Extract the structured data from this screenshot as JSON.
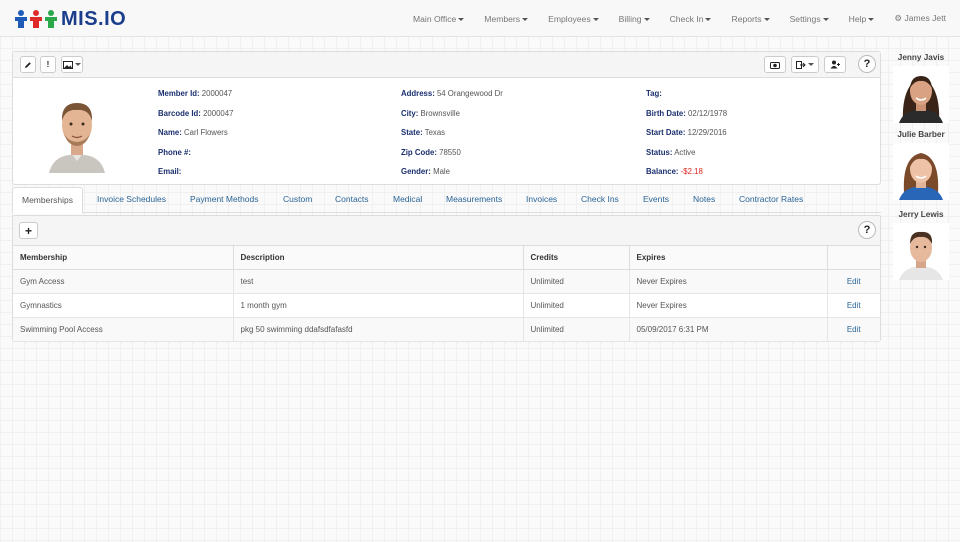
{
  "app": {
    "logo_text": "MIS.IO"
  },
  "nav": {
    "items": [
      "Main Office",
      "Members",
      "Employees",
      "Billing",
      "Check In",
      "Reports",
      "Settings",
      "Help"
    ],
    "user": "James Jett"
  },
  "colors": {
    "accent": "#2a6496",
    "brand": "#1a3d8c",
    "label": "#1a2f6e",
    "negative": "#d9261c"
  },
  "member": {
    "member_id_label": "Member Id:",
    "member_id": "2000047",
    "barcode_label": "Barcode Id:",
    "barcode": "2000047",
    "name_label": "Name:",
    "name": "Carl Flowers",
    "phone_label": "Phone #:",
    "phone": "",
    "email_label": "Email:",
    "email": "",
    "address_label": "Address:",
    "address": "54 Orangewood Dr",
    "city_label": "City:",
    "city": "Brownsville",
    "state_label": "State:",
    "state": "Texas",
    "zip_label": "Zip Code:",
    "zip": "78550",
    "gender_label": "Gender:",
    "gender": "Male",
    "tag_label": "Tag:",
    "tag": "",
    "birth_label": "Birth Date:",
    "birth": "02/12/1978",
    "start_label": "Start Date:",
    "start": "12/29/2016",
    "status_label": "Status:",
    "status": "Active",
    "balance_label": "Balance:",
    "balance": "-$2.18"
  },
  "tabs": [
    "Memberships",
    "Invoice Schedules",
    "Payment Methods",
    "Custom",
    "Contacts",
    "Medical",
    "Measurements",
    "Invoices",
    "Check Ins",
    "Events",
    "Notes",
    "Contractor Rates"
  ],
  "table": {
    "headers": [
      "Membership",
      "Description",
      "Credits",
      "Expires",
      ""
    ],
    "rows": [
      {
        "membership": "Gym Access",
        "description": "test",
        "credits": "Unlimited",
        "expires": "Never Expires",
        "action": "Edit"
      },
      {
        "membership": "Gymnastics",
        "description": "1 month gym",
        "credits": "Unlimited",
        "expires": "Never Expires",
        "action": "Edit"
      },
      {
        "membership": "Swimming Pool Access",
        "description": "pkg 50 swimming ddafsdfafasfd",
        "credits": "Unlimited",
        "expires": "05/09/2017 6:31 PM",
        "action": "Edit"
      }
    ]
  },
  "staff": [
    {
      "name": "Jenny Javis"
    },
    {
      "name": "Julie Barber"
    },
    {
      "name": "Jerry Lewis"
    }
  ],
  "toolbar": {
    "help": "?",
    "add": "+",
    "alert": "!"
  }
}
